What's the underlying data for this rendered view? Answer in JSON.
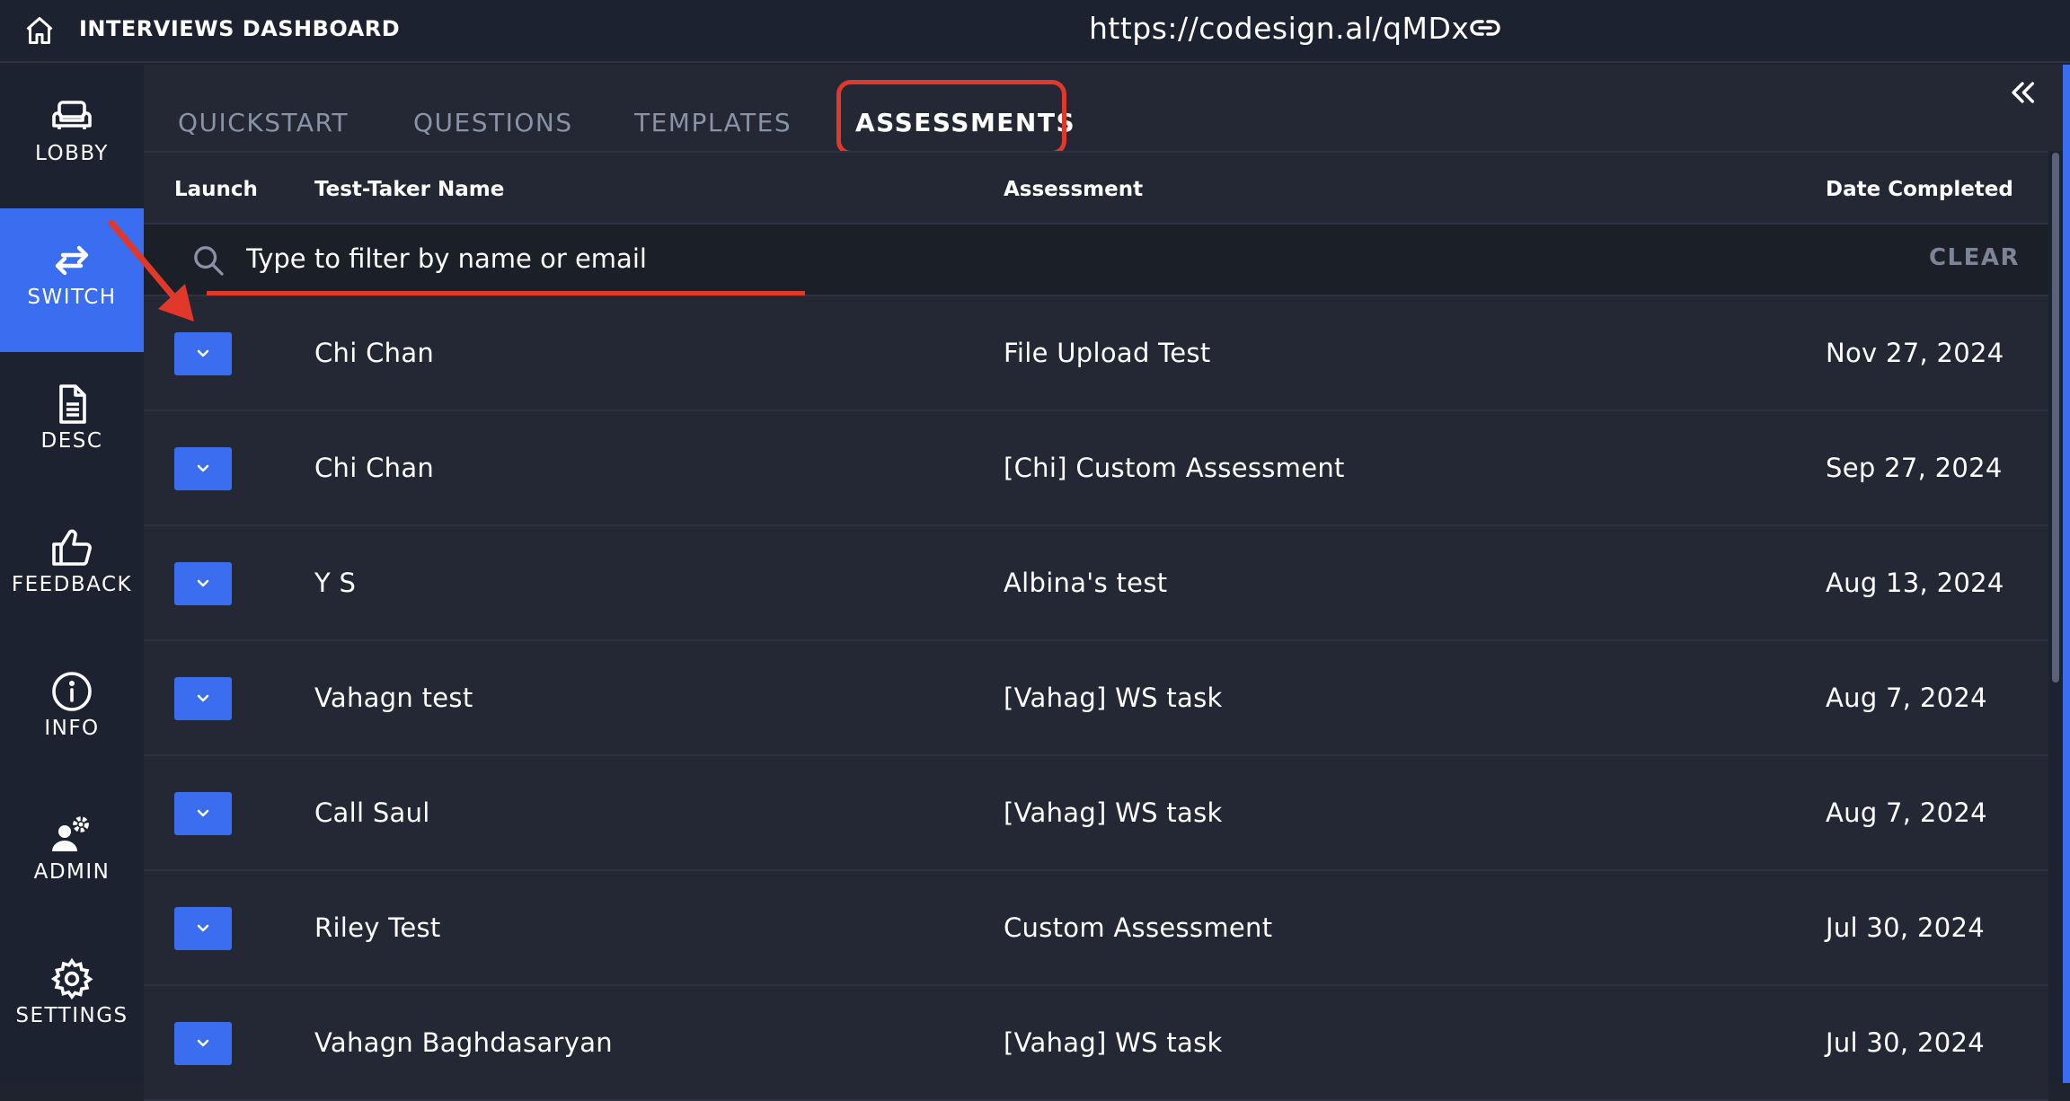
{
  "header": {
    "title": "INTERVIEWS DASHBOARD",
    "url": "https://codesign.al/qMDx"
  },
  "sidebar": {
    "items": [
      {
        "label": "LOBBY",
        "icon": "couch-icon",
        "active": false
      },
      {
        "label": "SWITCH",
        "icon": "swap-arrows-icon",
        "active": true
      },
      {
        "label": "DESC",
        "icon": "document-icon",
        "active": false
      },
      {
        "label": "FEEDBACK",
        "icon": "thumbs-up-icon",
        "active": false
      },
      {
        "label": "INFO",
        "icon": "info-icon",
        "active": false
      },
      {
        "label": "ADMIN",
        "icon": "user-gear-icon",
        "active": false
      },
      {
        "label": "SETTINGS",
        "icon": "gear-icon",
        "active": false
      }
    ]
  },
  "tabs": [
    {
      "label": "QUICKSTART",
      "active": false
    },
    {
      "label": "QUESTIONS",
      "active": false
    },
    {
      "label": "TEMPLATES",
      "active": false
    },
    {
      "label": "ASSESSMENTS",
      "active": true
    }
  ],
  "table": {
    "headers": {
      "launch": "Launch",
      "name": "Test-Taker Name",
      "assessment": "Assessment",
      "date": "Date Completed"
    },
    "filter": {
      "placeholder": "Type to filter by name or email",
      "clear_label": "CLEAR"
    },
    "rows": [
      {
        "name": "Chi Chan",
        "assessment": "File Upload Test",
        "date": "Nov 27, 2024"
      },
      {
        "name": "Chi Chan",
        "assessment": "[Chi] Custom Assessment",
        "date": "Sep 27, 2024"
      },
      {
        "name": "Y S",
        "assessment": "Albina's test",
        "date": "Aug 13, 2024"
      },
      {
        "name": "Vahagn test",
        "assessment": "[Vahag] WS task",
        "date": "Aug 7, 2024"
      },
      {
        "name": "Call Saul",
        "assessment": "[Vahag] WS task",
        "date": "Aug 7, 2024"
      },
      {
        "name": "Riley Test",
        "assessment": "Custom Assessment",
        "date": "Jul 30, 2024"
      },
      {
        "name": "Vahagn Baghdasaryan",
        "assessment": "[Vahag] WS task",
        "date": "Jul 30, 2024"
      }
    ]
  },
  "colors": {
    "accent": "#3a6df0",
    "annotation": "#e0392b",
    "background": "#232834"
  }
}
